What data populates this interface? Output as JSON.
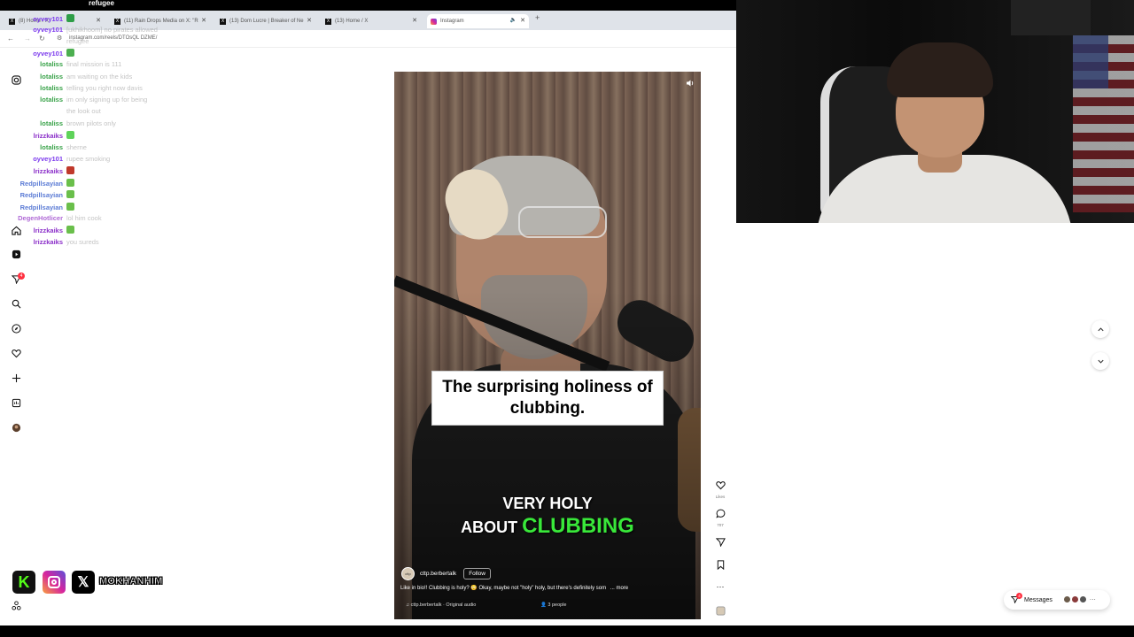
{
  "stream": {
    "title": "refugee"
  },
  "browser": {
    "tabs": [
      {
        "label": "(8) Home / X",
        "icon": "x-logo-icon"
      },
      {
        "label": "(11) Rain Drops Media on X: \"R",
        "icon": "x-logo-icon"
      },
      {
        "label": "(13) Dom Lucre | Breaker of Ne",
        "icon": "x-logo-icon"
      },
      {
        "label": "(13) Home / X",
        "icon": "x-logo-icon"
      },
      {
        "label": "Instagram",
        "icon": "instagram-icon",
        "active": true
      }
    ],
    "url": "instagram.com/reels/DTOsQL DZME/"
  },
  "chat": [
    {
      "user": "oyvey101",
      "color": "#7c3aed",
      "msg": "",
      "emote": "#2e9e48"
    },
    {
      "user": "oyvey101",
      "color": "#7c3aed",
      "msg": "[ukhikhoom] no pirates allowed"
    },
    {
      "user": "",
      "color": "#7c3aed",
      "msg": "refugee"
    },
    {
      "user": "oyvey101",
      "color": "#7c3aed",
      "msg": "",
      "emote": "#4caf50"
    },
    {
      "user": "lotaliss",
      "color": "#3aa34a",
      "msg": "final mission is 111"
    },
    {
      "user": "lotaliss",
      "color": "#3aa34a",
      "msg": "am waiting on the kids"
    },
    {
      "user": "lotaliss",
      "color": "#3aa34a",
      "msg": "telling you right now davis"
    },
    {
      "user": "lotaliss",
      "color": "#3aa34a",
      "msg": "im only signing up for being"
    },
    {
      "user": "",
      "color": "#3aa34a",
      "msg": "the look out"
    },
    {
      "user": "lotaliss",
      "color": "#3aa34a",
      "msg": "brown pilots only"
    },
    {
      "user": "lrizzkaiks",
      "color": "#8b2fc9",
      "msg": "",
      "emote": "#5fd35a"
    },
    {
      "user": "lotaliss",
      "color": "#3aa34a",
      "msg": "sherne"
    },
    {
      "user": "oyvey101",
      "color": "#7c3aed",
      "msg": "rupee smoking"
    },
    {
      "user": "lrizzkaiks",
      "color": "#8b2fc9",
      "msg": "",
      "emote": "#c0392b"
    },
    {
      "user": "Redpillsayian",
      "color": "#5b7bd5",
      "msg": "",
      "emote": "#6abf4b"
    },
    {
      "user": "Redpillsayian",
      "color": "#5b7bd5",
      "msg": "",
      "emote": "#6abf4b"
    },
    {
      "user": "Redpillsayian",
      "color": "#5b7bd5",
      "msg": "",
      "emote": "#6abf4b"
    },
    {
      "user": "DegenHotlicer",
      "color": "#b06ad6",
      "msg": "lol him cook"
    },
    {
      "user": "lrizzkaiks",
      "color": "#8b2fc9",
      "msg": "",
      "emote": "#6abf4b"
    },
    {
      "user": "lrizzkaiks",
      "color": "#8b2fc9",
      "msg": "you sureds"
    }
  ],
  "rail": {
    "badge_count": "4"
  },
  "reel": {
    "caption_box": "The surprising holiness of clubbing.",
    "subtitle_line1": "VERY HOLY",
    "subtitle_line2_pre": "ABOUT",
    "subtitle_line2_highlight": "CLUBBING",
    "username": "cttp.berbertalk",
    "follow_label": "Follow",
    "caption": "Like in bio!! Clubbing is holy? 😳 Okay, maybe not \"holy\" holy, but there's definitely som",
    "more_label": "... more",
    "audio": "cttp.berbertalk · Original audio",
    "people": "3 people",
    "likes_label": "Likes",
    "comments_count": "707"
  },
  "messages": {
    "label": "Messages",
    "badge": "4"
  },
  "socials": {
    "handle": "MOKHANHIM",
    "kick_letter": "K",
    "x_letter": "𝕏"
  },
  "colors": {
    "highlight_green": "#39e83a",
    "instagram_badge": "#ff3040"
  }
}
